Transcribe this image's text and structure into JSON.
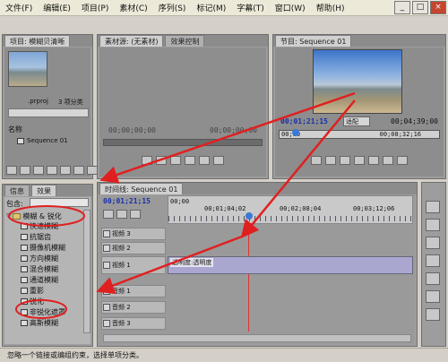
{
  "menu": [
    "文件(F)",
    "编辑(E)",
    "项目(P)",
    "素材(C)",
    "序列(S)",
    "标记(M)",
    "字幕(T)",
    "窗口(W)",
    "帮助(H)"
  ],
  "window_buttons": {
    "min": "_",
    "max": "□",
    "close": "×"
  },
  "project": {
    "tab_label": "项目: 模糊贝清晰",
    "file_name": ".prproj",
    "item_count": "3 项分类",
    "name_header": "名称",
    "sequence_name": "Sequence 01"
  },
  "source_monitor": {
    "tab1": "素材源: (无素材)",
    "tab2": "效果控制",
    "timecode_left": "00;00;00;00",
    "timecode_right": "00;00;00;00"
  },
  "program_monitor": {
    "tab": "节目: Sequence 01",
    "timecode": "00;01;21;15",
    "fit": "适配",
    "duration": "00;04;39;00",
    "ruler_left": "00;00",
    "ruler_right": "00;08;32;16"
  },
  "effects": {
    "tab_info": "信息",
    "tab_effects": "效果",
    "contains_label": "包含:",
    "category": "模糊 & 锐化",
    "items": [
      "快速模糊",
      "抗锯齿",
      "摄像机模糊",
      "方向模糊",
      "混合模糊",
      "通道模糊",
      "重影",
      "锐化",
      "非锐化遮罩",
      "高斯模糊"
    ]
  },
  "timeline": {
    "tab": "时间线: Sequence 01",
    "timecode": "00;01;21;15",
    "ruler_labels": [
      "00;00",
      "00;01;04;02",
      "00;02;08;04",
      "00;03;12;06"
    ],
    "video_tracks": [
      "视频 3",
      "视频 2",
      "视频 1"
    ],
    "clip_label": "透明度:透明度",
    "audio_tracks": [
      "音频 1",
      "音频 2",
      "音频 3"
    ]
  },
  "status_text": "忽略一个链接或编组约束，选择单项分类。"
}
